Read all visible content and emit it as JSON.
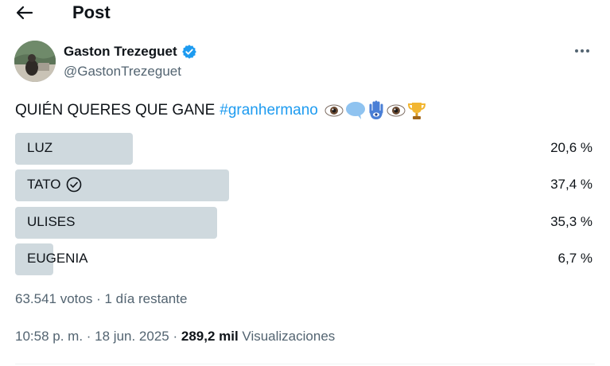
{
  "header": {
    "title": "Post",
    "back_icon": "arrow-left-icon"
  },
  "author": {
    "name": "Gaston Trezeguet",
    "handle": "@GastonTrezeguet",
    "verified": true,
    "verified_color": "#1d9bf0"
  },
  "tweet": {
    "text": "QUIÉN QUERES QUE GANE",
    "hashtag": "#granhermano",
    "emojis": [
      "eye-emoji",
      "speech-bubble-emoji",
      "hamsa-emoji",
      "eye-emoji",
      "trophy-emoji"
    ]
  },
  "poll": {
    "options": [
      {
        "label": "LUZ",
        "percent": "20,6 %",
        "value": 20.6,
        "selected": false
      },
      {
        "label": "TATO",
        "percent": "37,4 %",
        "value": 37.4,
        "selected": true
      },
      {
        "label": "ULISES",
        "percent": "35,3 %",
        "value": 35.3,
        "selected": false
      },
      {
        "label": "EUGENIA",
        "percent": "6,7 %",
        "value": 6.7,
        "selected": false
      }
    ],
    "meta": "63.541 votos · 1 día restante"
  },
  "footer": {
    "timestamp": "10:58 p. m. · 18 jun. 2025 · ",
    "views_count": "289,2 mil",
    "views_label": " Visualizaciones"
  },
  "colors": {
    "accent": "#1d9bf0",
    "bar": "#cfd9de",
    "muted": "#536471",
    "text": "#0f1419"
  }
}
